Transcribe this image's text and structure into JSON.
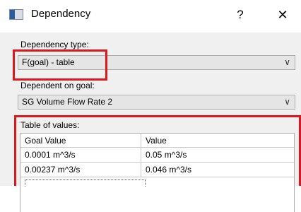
{
  "window": {
    "title": "Dependency",
    "help_label": "?",
    "close_label": "✕"
  },
  "dependency_type": {
    "label": "Dependency type:",
    "value": "F(goal) - table"
  },
  "dependent_on_goal": {
    "label": "Dependent on goal:",
    "value": "SG Volume Flow Rate 2"
  },
  "table": {
    "label": "Table of values:",
    "columns": [
      "Goal Value",
      "Value"
    ],
    "rows": [
      [
        "0.0001 m^3/s",
        "0.05 m^3/s"
      ],
      [
        "0.00237 m^3/s",
        "0.046 m^3/s"
      ]
    ]
  },
  "highlight_color": "#e0161d"
}
